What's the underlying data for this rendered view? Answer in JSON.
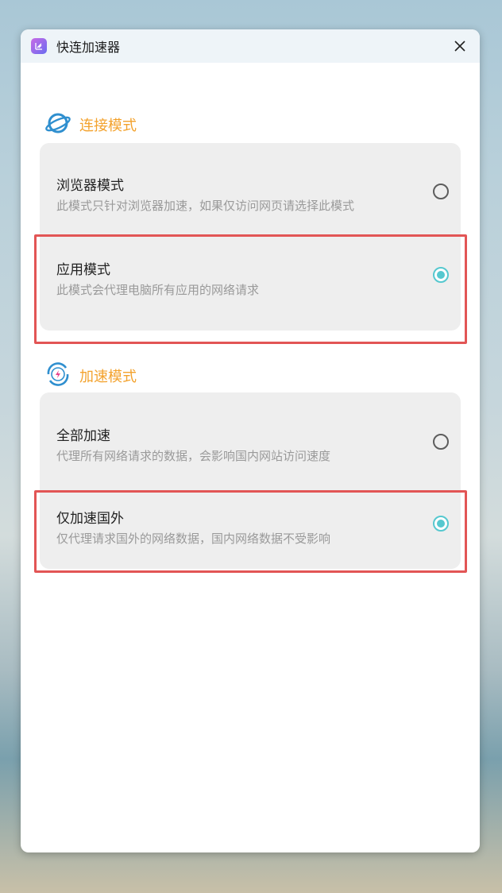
{
  "window": {
    "title": "快连加速器",
    "icon": "app-logo-icon",
    "close_icon": "close-icon"
  },
  "connection_mode": {
    "heading": "连接模式",
    "icon": "planet-icon",
    "options": [
      {
        "title": "浏览器模式",
        "description": "此模式只针对浏览器加速，如果仅访问网页请选择此模式",
        "selected": false
      },
      {
        "title": "应用模式",
        "description": "此模式会代理电脑所有应用的网络请求",
        "selected": true
      }
    ]
  },
  "acceleration_mode": {
    "heading": "加速模式",
    "icon": "lightning-icon",
    "options": [
      {
        "title": "全部加速",
        "description": "代理所有网络请求的数据，会影响国内网站访问速度",
        "selected": false
      },
      {
        "title": "仅加速国外",
        "description": "仅代理请求国外的网络数据，国内网络数据不受影响",
        "selected": true
      }
    ]
  },
  "colors": {
    "accent": "#56c8cf",
    "heading": "#f3a22d",
    "highlight": "#e25555"
  }
}
